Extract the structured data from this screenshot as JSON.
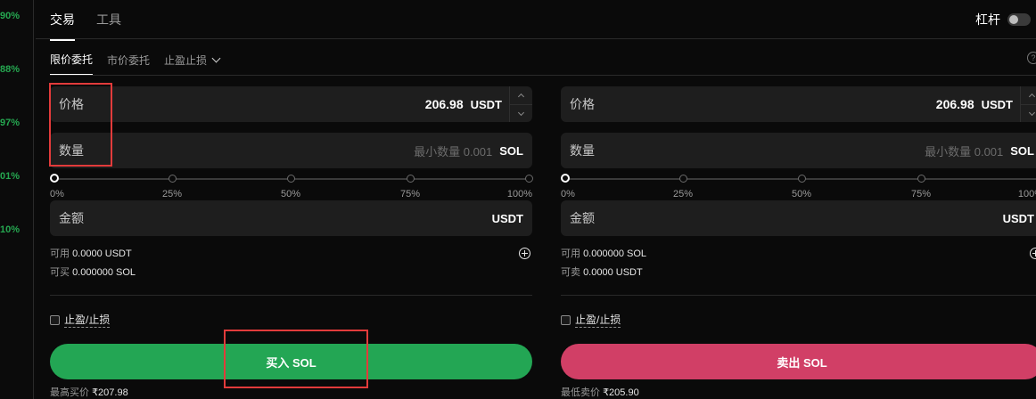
{
  "left_strip": {
    "percents": [
      "90%",
      "88%",
      "97%",
      "01%",
      "10%"
    ]
  },
  "header": {
    "tabs": [
      {
        "label": "交易"
      },
      {
        "label": "工具"
      }
    ],
    "leverage_label": "杠杆"
  },
  "order_types": [
    {
      "label": "限价委托"
    },
    {
      "label": "市价委托"
    },
    {
      "label": "止盈止损"
    }
  ],
  "help_glyph": "?",
  "slider_ticks": [
    "0%",
    "25%",
    "50%",
    "75%",
    "100%"
  ],
  "buy": {
    "price_label": "价格",
    "price_value": "206.98",
    "price_unit": "USDT",
    "qty_label": "数量",
    "qty_placeholder": "最小数量 0.001",
    "qty_unit": "SOL",
    "amount_label": "金额",
    "amount_unit": "USDT",
    "avail_label": "可用",
    "avail_value": "0.0000 USDT",
    "max_label": "可买",
    "max_value": "0.000000 SOL",
    "tpsl_label": "止盈/止损",
    "button_label": "买入 SOL",
    "best_label": "最高买价",
    "best_value": "₹207.98"
  },
  "sell": {
    "price_label": "价格",
    "price_value": "206.98",
    "price_unit": "USDT",
    "qty_label": "数量",
    "qty_placeholder": "最小数量 0.001",
    "qty_unit": "SOL",
    "amount_label": "金额",
    "amount_unit": "USDT",
    "avail_label": "可用",
    "avail_value": "0.000000 SOL",
    "max_label": "可卖",
    "max_value": "0.0000 USDT",
    "tpsl_label": "止盈/止损",
    "button_label": "卖出 SOL",
    "best_label": "最低卖价",
    "best_value": "₹205.90"
  },
  "colors": {
    "buy": "#23a654",
    "sell": "#d13f66",
    "annotation": "#e23b3b",
    "up_percent": "#25a750"
  }
}
